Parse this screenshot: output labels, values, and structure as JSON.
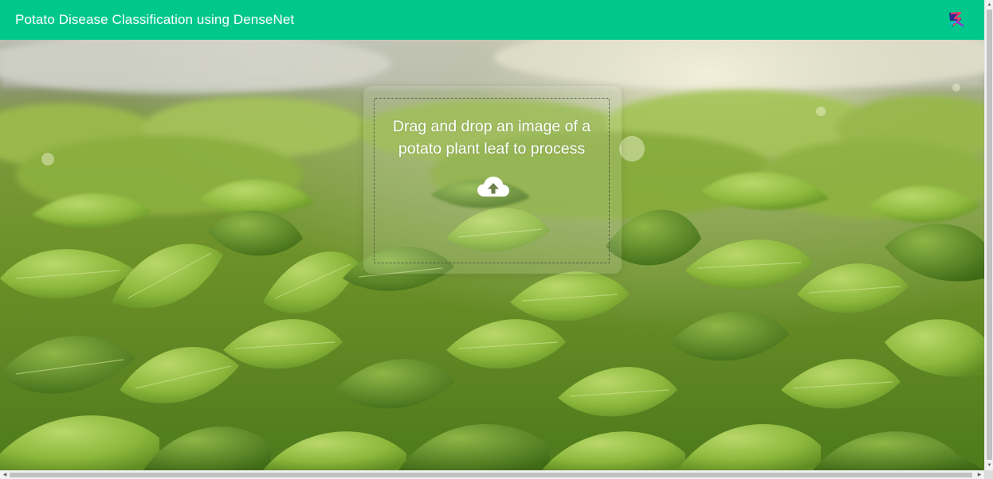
{
  "app": {
    "title": "Potato Disease Classification using DenseNet",
    "logo_icon": "brand-logo-icon",
    "accent_color": "#00c78c"
  },
  "dropzone": {
    "message": "Drag and drop an image of a potato plant leaf to process",
    "icon": "cloud-upload-icon"
  },
  "background": {
    "description_icon": "leaf-field-photo"
  },
  "scrollbars": {
    "up_arrow": "▲",
    "down_arrow": "▼",
    "left_arrow": "◀",
    "right_arrow": "▶"
  }
}
